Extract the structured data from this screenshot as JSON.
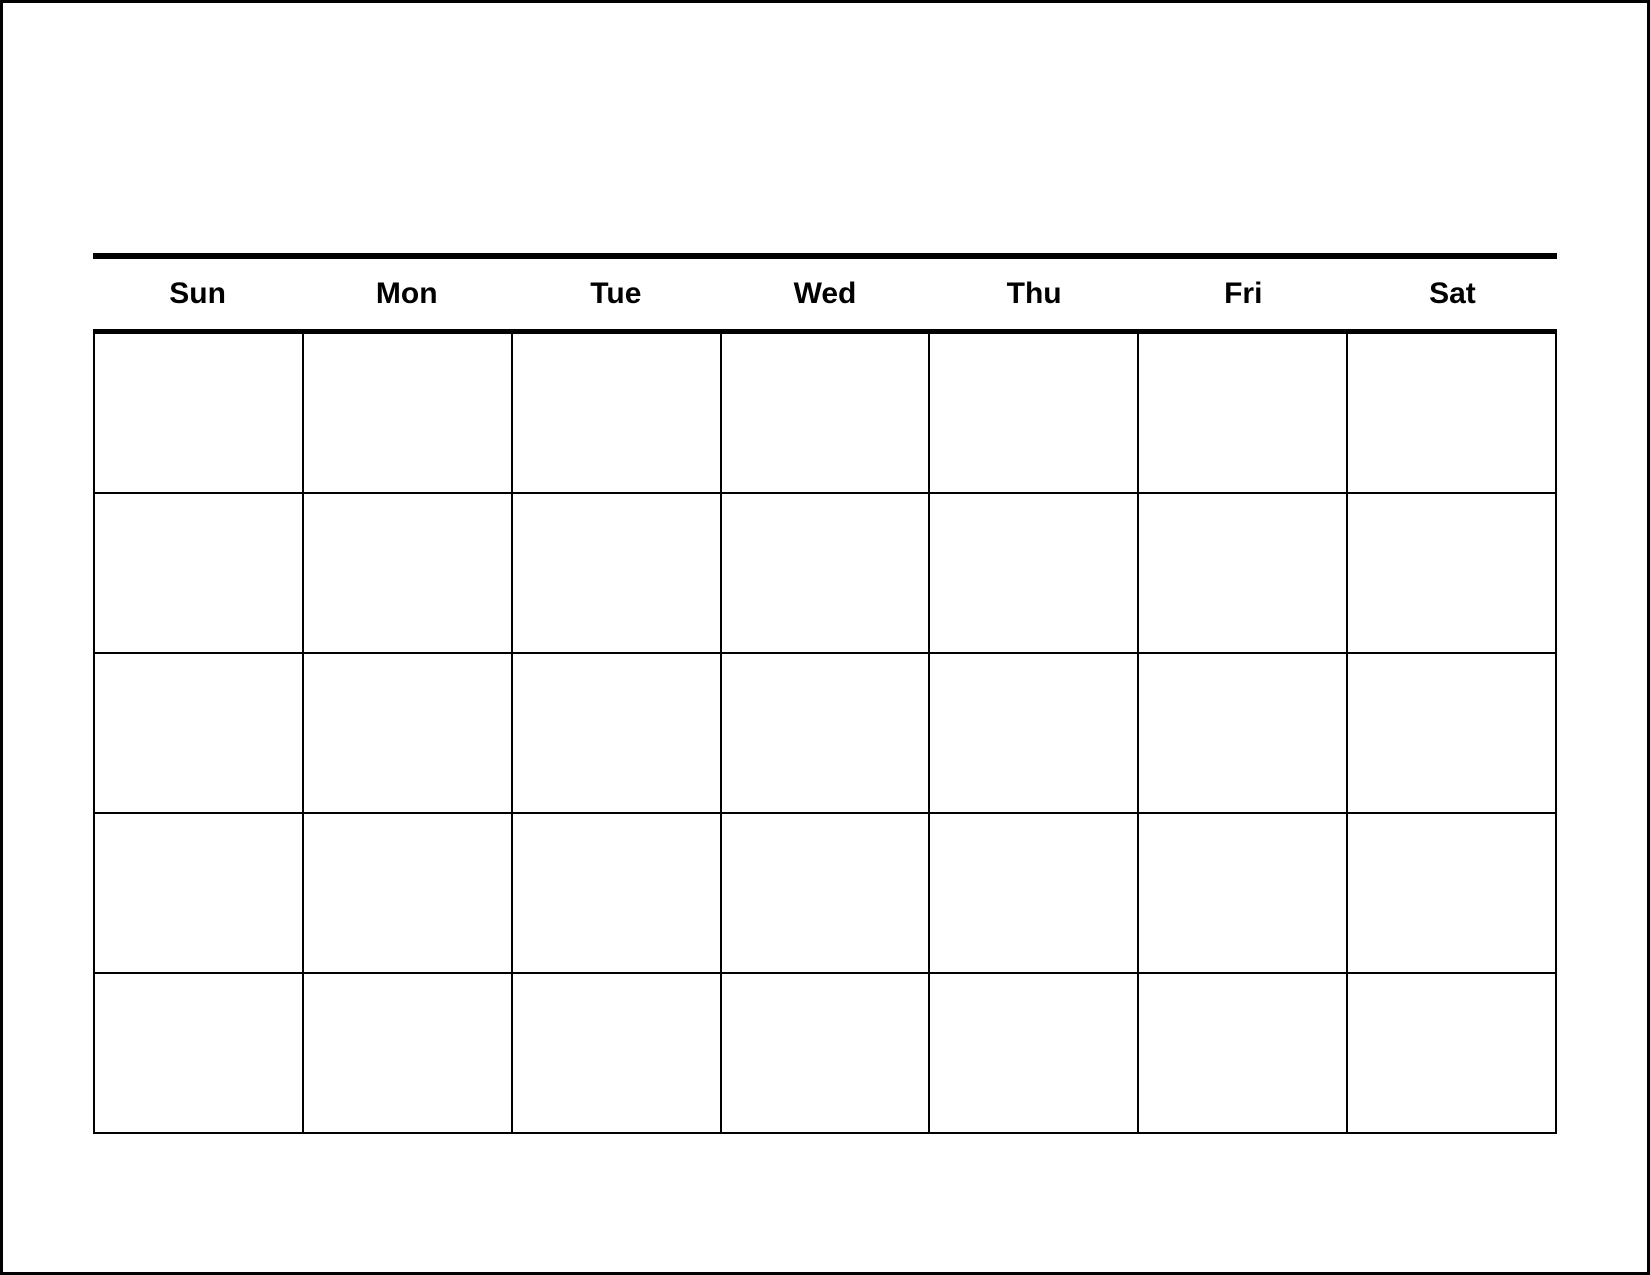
{
  "calendar": {
    "days": [
      "Sun",
      "Mon",
      "Tue",
      "Wed",
      "Thu",
      "Fri",
      "Sat"
    ],
    "rows": 5,
    "cols": 7,
    "cells": [
      [
        "",
        "",
        "",
        "",
        "",
        "",
        ""
      ],
      [
        "",
        "",
        "",
        "",
        "",
        "",
        ""
      ],
      [
        "",
        "",
        "",
        "",
        "",
        "",
        ""
      ],
      [
        "",
        "",
        "",
        "",
        "",
        "",
        ""
      ],
      [
        "",
        "",
        "",
        "",
        "",
        "",
        ""
      ]
    ]
  }
}
